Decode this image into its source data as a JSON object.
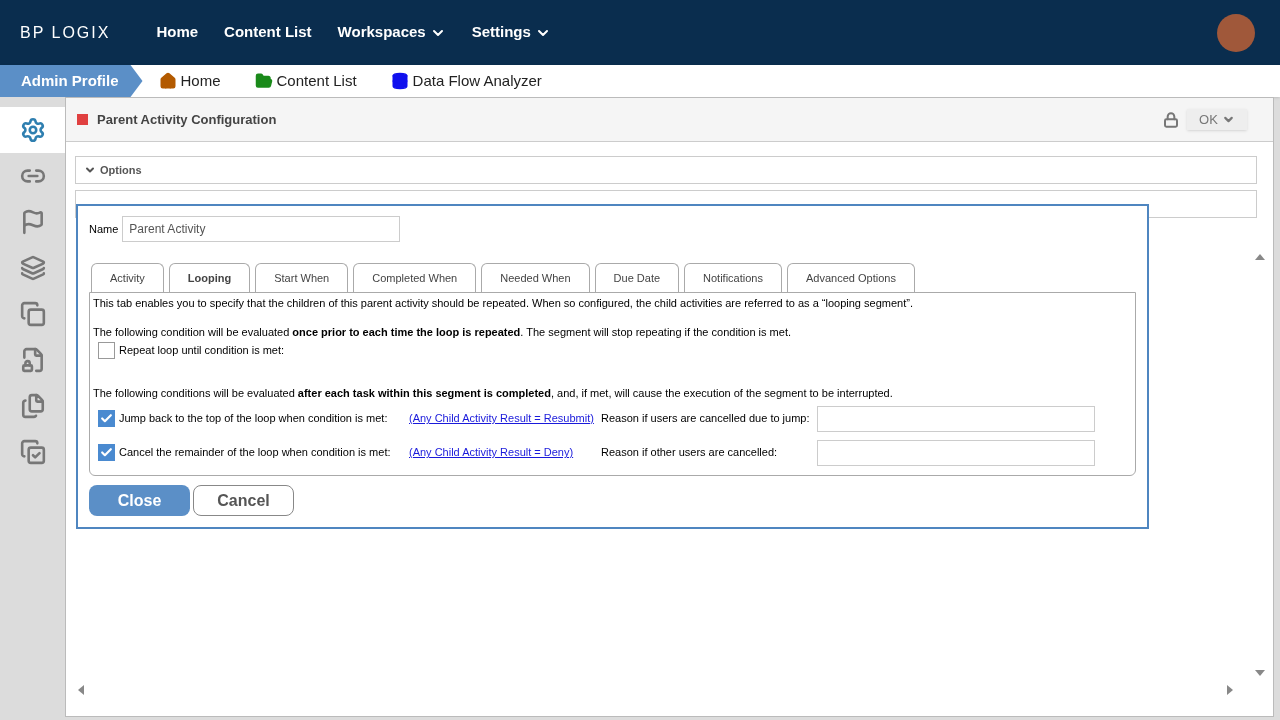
{
  "top_nav": {
    "logo": "BP LOGIX",
    "items": [
      {
        "label": "Home",
        "dropdown": false
      },
      {
        "label": "Content List",
        "dropdown": false
      },
      {
        "label": "Workspaces",
        "dropdown": true
      },
      {
        "label": "Settings",
        "dropdown": true
      }
    ]
  },
  "breadcrumb": {
    "profile": "Admin Profile",
    "links": [
      {
        "kind": "home",
        "label": "Home"
      },
      {
        "kind": "folder",
        "label": "Content List"
      },
      {
        "kind": "database",
        "label": "Data Flow Analyzer"
      }
    ]
  },
  "sidebar": {
    "items": [
      {
        "kind": "gears",
        "selected": true
      },
      {
        "kind": "link",
        "selected": false
      },
      {
        "kind": "flag",
        "selected": false
      },
      {
        "kind": "squares",
        "selected": false
      },
      {
        "kind": "copy-squares",
        "selected": false
      },
      {
        "kind": "locked-doc",
        "selected": false
      },
      {
        "kind": "pages",
        "selected": false
      },
      {
        "kind": "checked-pages",
        "selected": false
      }
    ]
  },
  "panel": {
    "title": "Parent Activity Configuration",
    "ok_button": "OK",
    "sections": [
      {
        "label": "Options",
        "expanded": true
      }
    ]
  },
  "dialog": {
    "name_label": "Name",
    "name_value": "Parent Activity",
    "tabs": [
      {
        "label": "Activity",
        "selected": false
      },
      {
        "label": "Looping",
        "selected": true
      },
      {
        "label": "Start When",
        "selected": false
      },
      {
        "label": "Completed When",
        "selected": false
      },
      {
        "label": "Needed When",
        "selected": false
      },
      {
        "label": "Due Date",
        "selected": false
      },
      {
        "label": "Notifications",
        "selected": false
      },
      {
        "label": "Advanced Options",
        "selected": false
      }
    ],
    "intro": "This tab enables you to specify that the children of this parent activity should be repeated. When so configured, the child activities are referred to as a “looping segment”.",
    "condition_note": "The following condition will be evaluated **once prior to each time the loop is repeated**. The segment will stop repeating if the condition is met.",
    "repeat": {
      "label": "Repeat loop until condition is met:",
      "checked": false
    },
    "conditions_note": "The following conditions will be evaluated **after each task within this segment is completed**, and, if met, will cause the execution of the segment to be interrupted.",
    "rules": [
      {
        "label": "Jump back to the top of the loop when condition is met:",
        "checked": true,
        "condition": "(Any Child Activity Result = Resubmit)",
        "reason_label": "Reason if users are cancelled due to jump:"
      },
      {
        "label": "Cancel the remainder of the loop when condition is met:",
        "checked": true,
        "condition": "(Any Child Activity Result = Deny)",
        "reason_label": "Reason if other users are cancelled:"
      }
    ],
    "buttons": [
      {
        "kind": "primary",
        "label": "Close"
      },
      {
        "kind": "secondary",
        "label": "Cancel"
      }
    ]
  }
}
